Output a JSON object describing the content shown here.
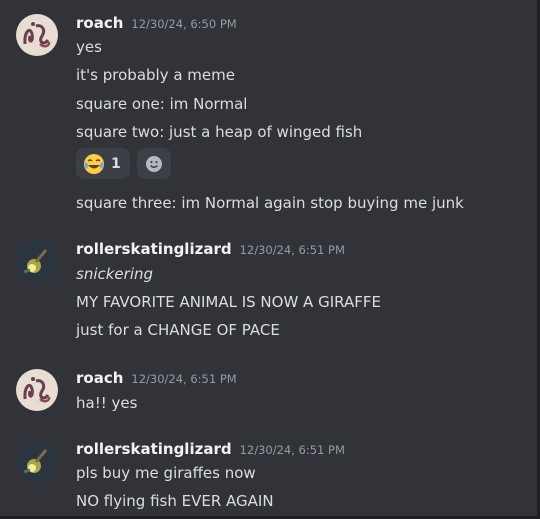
{
  "messages": [
    {
      "username": "roach",
      "timestamp": "12/30/24, 6:50 PM",
      "lines": [
        "yes",
        "it's probably a meme",
        "square one: im Normal",
        "square two: just a heap of winged fish"
      ],
      "reaction": {
        "icon": "joy-emoji-icon",
        "count": "1"
      },
      "lines_after": [
        "square three: im Normal again stop buying me junk"
      ]
    },
    {
      "username": "rollerskatinglizard",
      "timestamp": "12/30/24, 6:51 PM",
      "lines": [
        "snickering",
        "MY FAVORITE ANIMAL IS NOW A GIRAFFE",
        "just for a CHANGE OF PACE"
      ]
    },
    {
      "username": "roach",
      "timestamp": "12/30/24, 6:51 PM",
      "lines": [
        "ha!! yes"
      ]
    },
    {
      "username": "rollerskatinglizard",
      "timestamp": "12/30/24, 6:51 PM",
      "lines": [
        "pls buy me giraffes now",
        "NO flying fish EVER AGAIN"
      ]
    }
  ],
  "colors": {
    "background": "#313338",
    "username": "#f2f3f5",
    "timestamp": "#949ba4",
    "text": "#dbdee1",
    "reaction_bg": "#3c3f45"
  },
  "icons": {
    "add_reaction": "add-reaction-smiley-icon"
  }
}
